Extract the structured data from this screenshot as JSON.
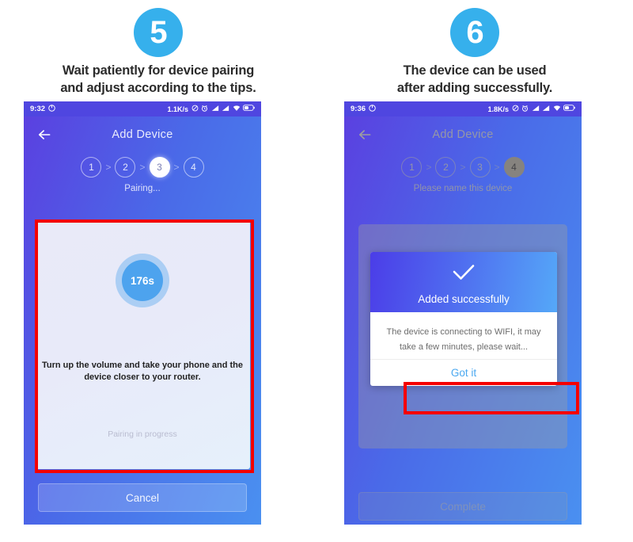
{
  "steps": [
    {
      "badge": "5",
      "caption_line1": "Wait patiently for device pairing",
      "caption_line2": "and adjust according to the tips.",
      "phone": {
        "statusbar": {
          "time": "9:32",
          "net_speed": "1.1K/s",
          "icons": [
            "do-not-disturb-icon",
            "alarm-icon",
            "signal-bars-icon",
            "signal-bars-icon",
            "wifi-icon",
            "battery-icon"
          ]
        },
        "appbar": {
          "back": "back-arrow-icon",
          "title": "Add Device"
        },
        "stepper": {
          "items": [
            "1",
            "2",
            "3",
            "4"
          ],
          "active_index": 2,
          "separator": ">"
        },
        "substatus": "Pairing...",
        "card": {
          "timer": "176s",
          "hint": "Turn up the volume and take your phone and the device closer to your router.",
          "progress": "Pairing in progress"
        },
        "bottom_button": "Cancel"
      }
    },
    {
      "badge": "6",
      "caption_line1": "The device can be used",
      "caption_line2": "after adding successfully.",
      "phone": {
        "statusbar": {
          "time": "9:36",
          "net_speed": "1.8K/s",
          "icons": [
            "do-not-disturb-icon",
            "alarm-icon",
            "signal-bars-icon",
            "signal-bars-icon",
            "wifi-icon",
            "battery-icon"
          ]
        },
        "appbar": {
          "back": "back-arrow-icon",
          "title": "Add Device"
        },
        "stepper": {
          "items": [
            "1",
            "2",
            "3",
            "4"
          ],
          "active_index": 3,
          "separator": ">"
        },
        "substatus": "Please name this device",
        "dialog": {
          "check": "check-icon",
          "title": "Added successfully",
          "body_line1": "The device is connecting to WIFI, it may",
          "body_line2": "take a few minutes, please wait...",
          "action": "Got it"
        },
        "bottom_button": "Complete"
      }
    }
  ],
  "annotations": {
    "highlight_color": "#f40000",
    "boxes": [
      "pairing-card-highlight",
      "got-it-button-highlight"
    ]
  },
  "colors": {
    "badge": "#36b0ec",
    "header_gradient_start": "#5b3fe0",
    "header_gradient_end": "#4a90f0",
    "statusbar": "#4f46e0",
    "timer": "#4da3ee",
    "link": "#4aa8f0"
  }
}
